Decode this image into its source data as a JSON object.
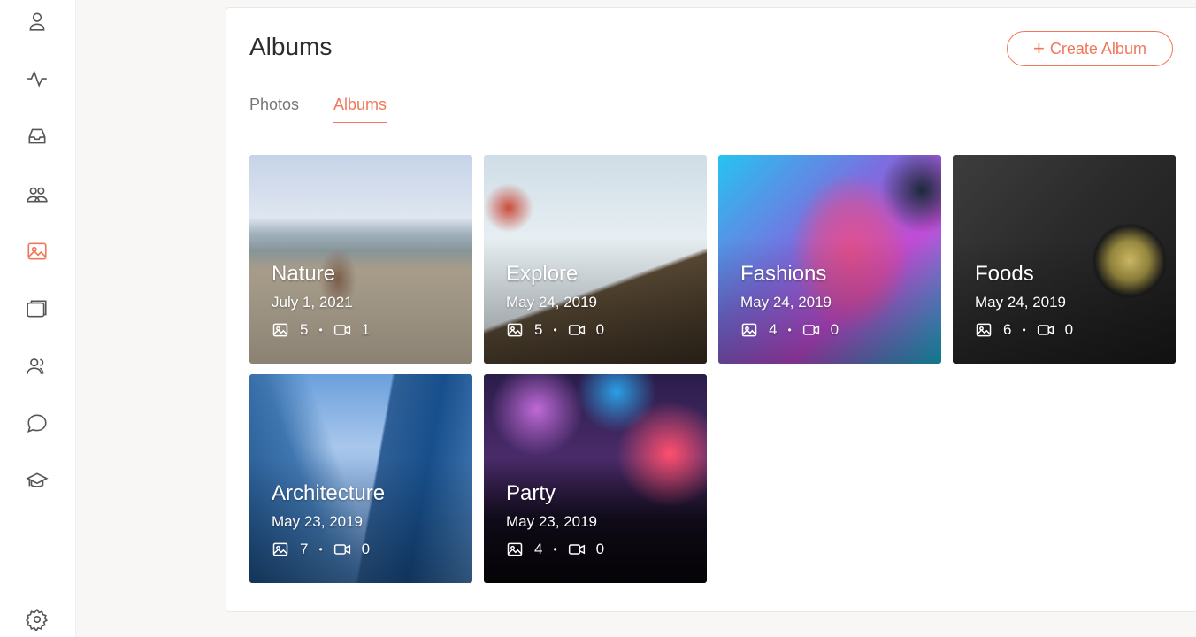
{
  "sidebar": {
    "items": [
      {
        "icon": "user-icon",
        "active": false
      },
      {
        "icon": "activity-icon",
        "active": false
      },
      {
        "icon": "inbox-icon",
        "active": false
      },
      {
        "icon": "users-group-icon",
        "active": false
      },
      {
        "icon": "image-icon",
        "active": true
      },
      {
        "icon": "folders-icon",
        "active": false
      },
      {
        "icon": "contacts-icon",
        "active": false
      },
      {
        "icon": "chat-icon",
        "active": false
      },
      {
        "icon": "graduation-cap-icon",
        "active": false
      }
    ],
    "footer_icon": "settings-icon",
    "active_color": "#f0775b"
  },
  "header": {
    "title": "Albums",
    "create_button": {
      "plus": "+",
      "label": "Create Album"
    }
  },
  "tabs": [
    {
      "label": "Photos",
      "active": false
    },
    {
      "label": "Albums",
      "active": true
    }
  ],
  "albums": [
    {
      "title": "Nature",
      "date": "July 1, 2021",
      "photos": "5",
      "videos": "1"
    },
    {
      "title": "Explore",
      "date": "May 24, 2019",
      "photos": "5",
      "videos": "0"
    },
    {
      "title": "Fashions",
      "date": "May 24, 2019",
      "photos": "4",
      "videos": "0"
    },
    {
      "title": "Foods",
      "date": "May 24, 2019",
      "photos": "6",
      "videos": "0"
    },
    {
      "title": "Architecture",
      "date": "May 23, 2019",
      "photos": "7",
      "videos": "0"
    },
    {
      "title": "Party",
      "date": "May 23, 2019",
      "photos": "4",
      "videos": "0"
    }
  ],
  "separator": "•",
  "accent_color": "#f0775b"
}
